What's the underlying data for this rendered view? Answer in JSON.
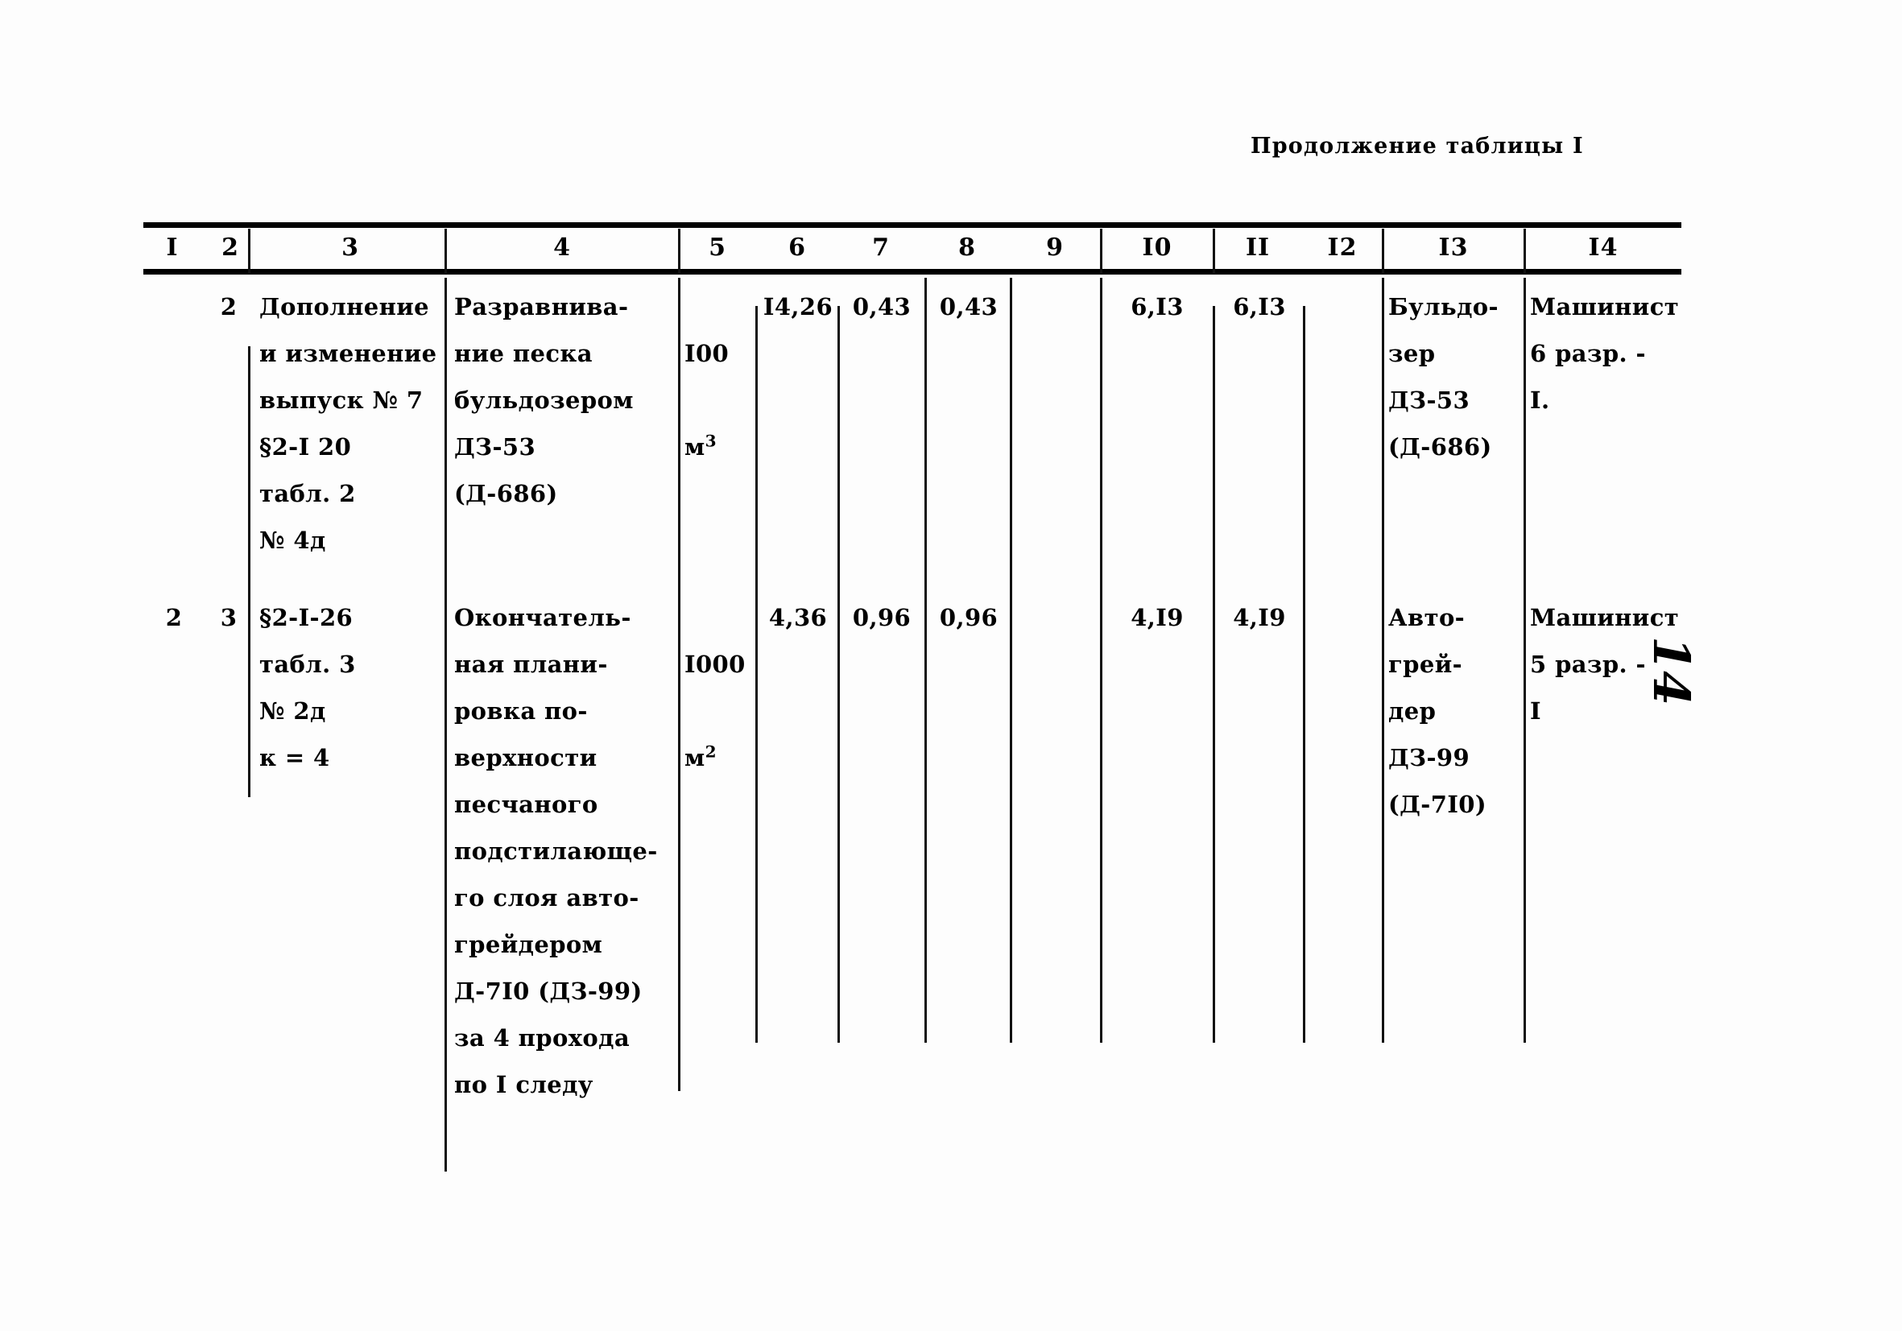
{
  "document": {
    "caption": "Продолжение таблицы I",
    "folio": "14"
  },
  "table": {
    "column_headers": [
      "I",
      "2",
      "3",
      "4",
      "5",
      "6",
      "7",
      "8",
      "9",
      "I0",
      "II",
      "I2",
      "I3",
      "I4"
    ],
    "rows": [
      {
        "c1": "",
        "c2": "2",
        "c3": "Дополнение\nи изменение\nвыпуск № 7\n§2-I 20\nтабл. 2\n№ 4д",
        "c4": "Разравнива-\nние песка\nбульдозером\nДЗ-53\n(Д-686)",
        "c5_value": "I00",
        "c5_unit": "м",
        "c5_unit_sup": "3",
        "c6": "I4,26",
        "c7": "0,43",
        "c8": "0,43",
        "c9": "",
        "c10": "6,I3",
        "c11": "6,I3",
        "c12": "",
        "c13": "Бульдо-\nзер\nДЗ-53\n(Д-686)",
        "c14": "Машинист\n6 разр. -\nI."
      },
      {
        "c1": "2",
        "c2": "3",
        "c3": "§2-I-26\nтабл. 3\n№ 2д\nк = 4",
        "c4": "Окончатель-\nная плани-\nровка по-\nверхности\nпесчаного\nподстилающе-\nго слоя авто-\nгрейдером\nД-7I0 (ДЗ-99)\nза 4 прохода\nпо I следу",
        "c5_value": "I000",
        "c5_unit": "м",
        "c5_unit_sup": "2",
        "c6": "4,36",
        "c7": "0,96",
        "c8": "0,96",
        "c9": "",
        "c10": "4,I9",
        "c11": "4,I9",
        "c12": "",
        "c13": "Авто-\nгрей-\nдер\nДЗ-99\n(Д-7I0)",
        "c14": "Машинист\n5 разр. -\nI"
      }
    ]
  }
}
